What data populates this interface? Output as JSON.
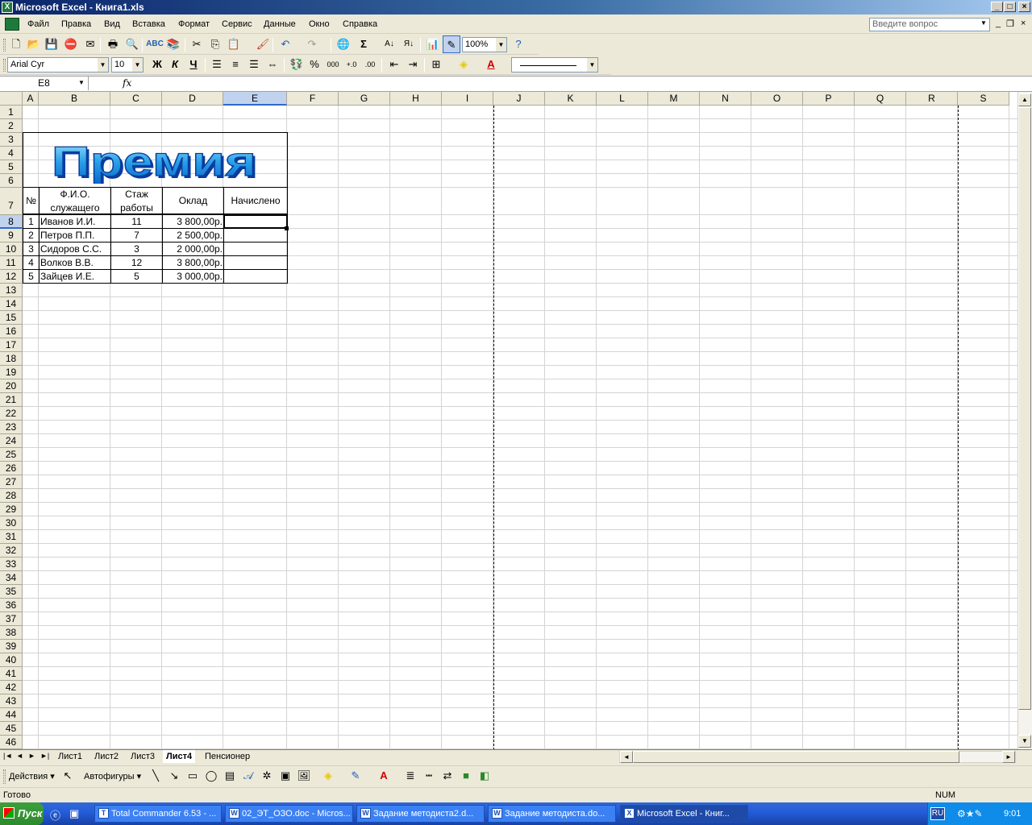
{
  "window": {
    "title": "Microsoft Excel - Книга1.xls",
    "app_icon": "X",
    "min_label": "_",
    "max_label": "□",
    "close_label": "×"
  },
  "menu": {
    "items": [
      "Файл",
      "Правка",
      "Вид",
      "Вставка",
      "Формат",
      "Сервис",
      "Данные",
      "Окно",
      "Справка"
    ],
    "help_placeholder": "Введите вопрос"
  },
  "toolbar": {
    "zoom": "100%",
    "font_name": "Arial Cyr",
    "font_size": "10",
    "bold": "Ж",
    "italic": "К",
    "underline": "Ч",
    "percent": "%",
    "thousands": "000",
    "sum": "Σ",
    "font_color_letter": "A"
  },
  "formula_bar": {
    "name_box": "E8",
    "fx": "fx",
    "content": ""
  },
  "grid": {
    "columns": [
      "A",
      "B",
      "C",
      "D",
      "E",
      "F",
      "G",
      "H",
      "I",
      "J",
      "K",
      "L",
      "M",
      "N",
      "O",
      "P",
      "Q",
      "R",
      "S"
    ],
    "rows": [
      "1",
      "2",
      "3",
      "4",
      "5",
      "6",
      "7",
      "8",
      "9",
      "10",
      "11",
      "12",
      "13",
      "14",
      "15",
      "16",
      "17",
      "18",
      "19",
      "20",
      "21",
      "22",
      "23",
      "24",
      "25",
      "26",
      "27",
      "28",
      "29",
      "30",
      "31",
      "32",
      "33",
      "34",
      "35",
      "36",
      "37",
      "38",
      "39",
      "40",
      "41",
      "42",
      "43",
      "44",
      "45",
      "46"
    ],
    "selected_col": "E",
    "selected_row": "8"
  },
  "table": {
    "wordart": "Премия",
    "headers": {
      "num": "№",
      "name": "Ф.И.О. служащего",
      "name_l1": "Ф.И.О.",
      "name_l2": "служащего",
      "exp": "Стаж работы",
      "exp_l1": "Стаж",
      "exp_l2": "работы",
      "salary": "Оклад",
      "accrued": "Начислено"
    },
    "rows": [
      {
        "n": "1",
        "name": "Иванов И.И.",
        "exp": "11",
        "salary": "3 800,00р.",
        "accrued": ""
      },
      {
        "n": "2",
        "name": "Петров П.П.",
        "exp": "7",
        "salary": "2 500,00р.",
        "accrued": ""
      },
      {
        "n": "3",
        "name": "Сидоров С.С.",
        "exp": "3",
        "salary": "2 000,00р.",
        "accrued": ""
      },
      {
        "n": "4",
        "name": "Волков В.В.",
        "exp": "12",
        "salary": "3 800,00р.",
        "accrued": ""
      },
      {
        "n": "5",
        "name": "Зайцев И.Е.",
        "exp": "5",
        "salary": "3 000,00р.",
        "accrued": ""
      }
    ]
  },
  "sheets": {
    "tabs": [
      "Лист1",
      "Лист2",
      "Лист3",
      "Лист4",
      "Пенсионер"
    ],
    "active": "Лист4"
  },
  "drawing": {
    "actions": "Действия",
    "autoshapes": "Автофигуры"
  },
  "status": {
    "ready": "Готово",
    "num": "NUM"
  },
  "taskbar": {
    "start": "Пуск",
    "tasks": [
      "Total Commander 6.53 - ...",
      "02_ЭТ_ОЗО.doc - Micros...",
      "Задание методиста2.d...",
      "Задание методиста.do...",
      "Microsoft Excel - Книг..."
    ],
    "lang": "RU",
    "clock": "9:01"
  },
  "colors": {
    "accent": "#316ac5",
    "wordart_fill": "#29a0e8",
    "wordart_outline": "#0a3c9e",
    "taskbar": "#245edb"
  }
}
